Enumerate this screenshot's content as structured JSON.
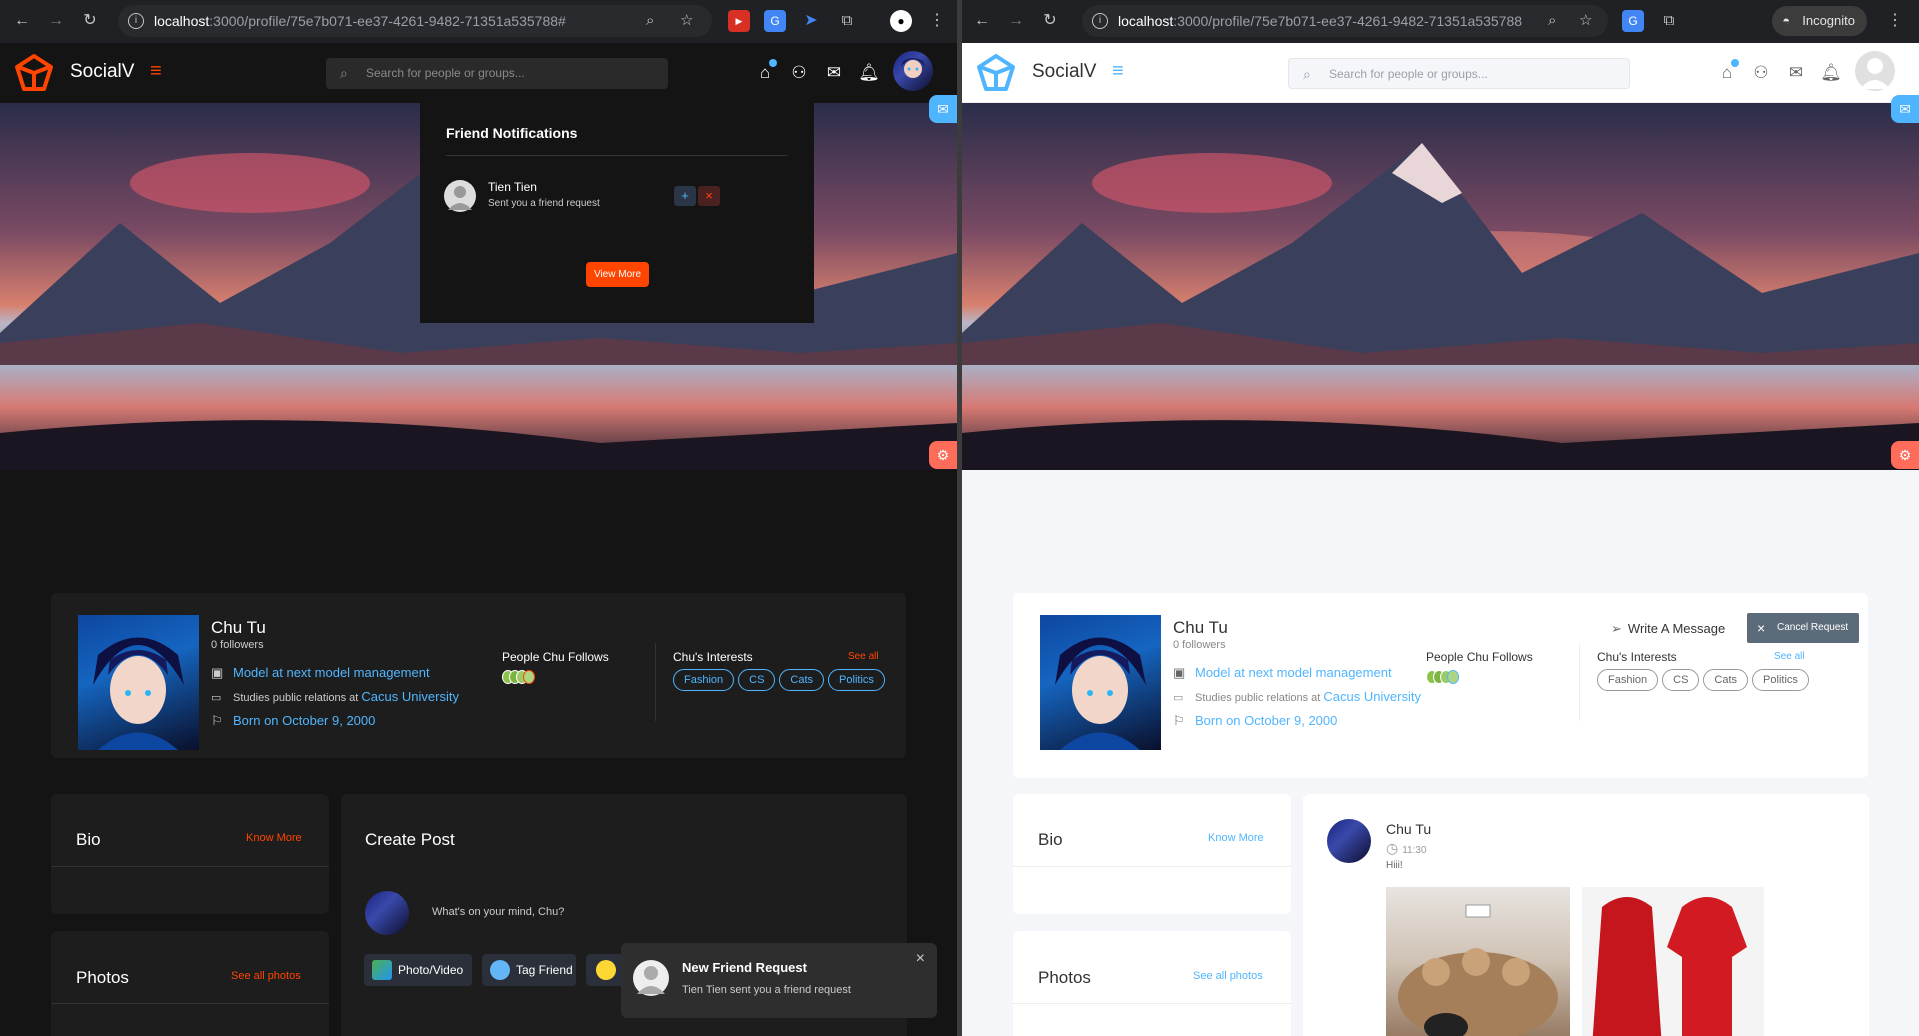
{
  "left": {
    "url_host": "localhost",
    "url_path": ":3000/profile/75e7b071-ee37-4261-9482-71351a535788#",
    "brand": "SocialV",
    "search_placeholder": "Search for people or groups...",
    "dropdown": {
      "title": "Friend Notifications",
      "name": "Tien Tien",
      "message": "Sent you a friend request",
      "view_more": "View More"
    },
    "profile": {
      "name": "Chu Tu",
      "followers": "0 followers",
      "job": "Model at next model management",
      "studies_prefix": "Studies public relations at",
      "university": "Cacus University",
      "born": "Born on October 9, 2000",
      "follows_title": "People Chu Follows",
      "interests_title": "Chu's Interests",
      "see_all": "See all",
      "interests": [
        "Fashion",
        "CS",
        "Cats",
        "Politics"
      ]
    },
    "bio": {
      "title": "Bio",
      "link": "Know More"
    },
    "photos": {
      "title": "Photos",
      "link": "See all photos"
    },
    "create_post": {
      "title": "Create Post",
      "prompt": "What's on your mind, Chu?",
      "photo_btn": "Photo/Video",
      "tag_btn": "Tag Friend"
    },
    "toast": {
      "title": "New Friend Request",
      "message": "Tien Tien sent you a friend request"
    }
  },
  "right": {
    "url_host": "localhost",
    "url_path": ":3000/profile/75e7b071-ee37-4261-9482-71351a535788",
    "incognito": "Incognito",
    "brand": "SocialV",
    "search_placeholder": "Search for people or groups...",
    "profile": {
      "name": "Chu Tu",
      "followers": "0 followers",
      "job": "Model at next model management",
      "studies_prefix": "Studies public relations at",
      "university": "Cacus University",
      "born": "Born on October 9, 2000",
      "follows_title": "People Chu Follows",
      "interests_title": "Chu's Interests",
      "see_all": "See all",
      "interests": [
        "Fashion",
        "CS",
        "Cats",
        "Politics"
      ],
      "write_message": "Write A Message",
      "cancel_request": "Cancel Request"
    },
    "bio": {
      "title": "Bio",
      "link": "Know More"
    },
    "photos": {
      "title": "Photos",
      "link": "See all photos"
    },
    "post": {
      "author": "Chu Tu",
      "time": "11:30",
      "text": "Hiii!"
    }
  },
  "colors": {
    "accent_orange": "#ff4500",
    "accent_blue": "#50b5ff",
    "dark_bg": "#141414",
    "light_bg": "#f5f6fa"
  }
}
